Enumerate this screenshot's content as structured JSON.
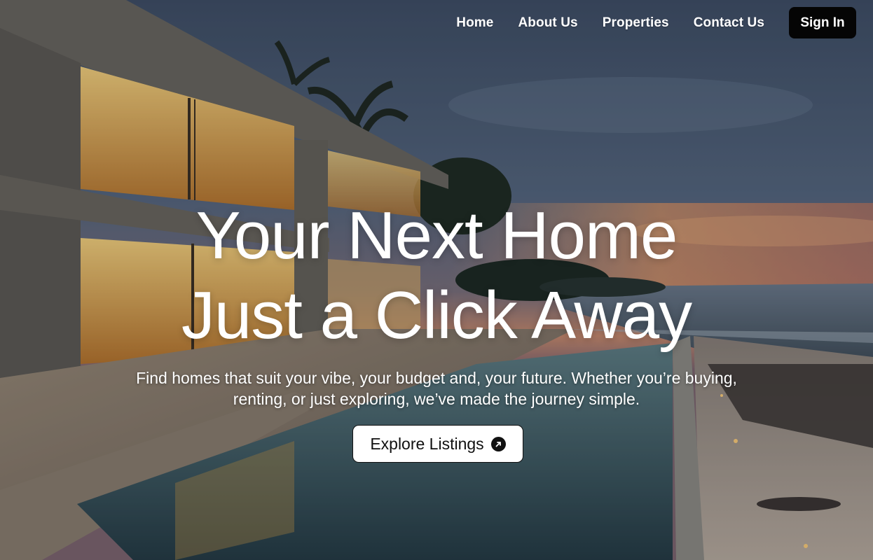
{
  "nav": {
    "links": [
      "Home",
      "About Us",
      "Properties",
      "Contact Us"
    ],
    "signin_label": "Sign In"
  },
  "hero": {
    "headline_line1": "Your Next Home",
    "headline_line2": "Just a Click Away",
    "subtitle_line1": "Find homes that suit your vibe, your budget and, your future. Whether you’re buying,",
    "subtitle_line2": "renting, or just exploring, we’ve made the journey simple.",
    "cta_label": "Explore Listings",
    "cta_icon": "arrow-up-right-circle-icon"
  },
  "colors": {
    "button_dark": "#050505",
    "text_light": "#ffffff",
    "sky_top": "#4a5a72",
    "sunset": "#e98a5c"
  }
}
